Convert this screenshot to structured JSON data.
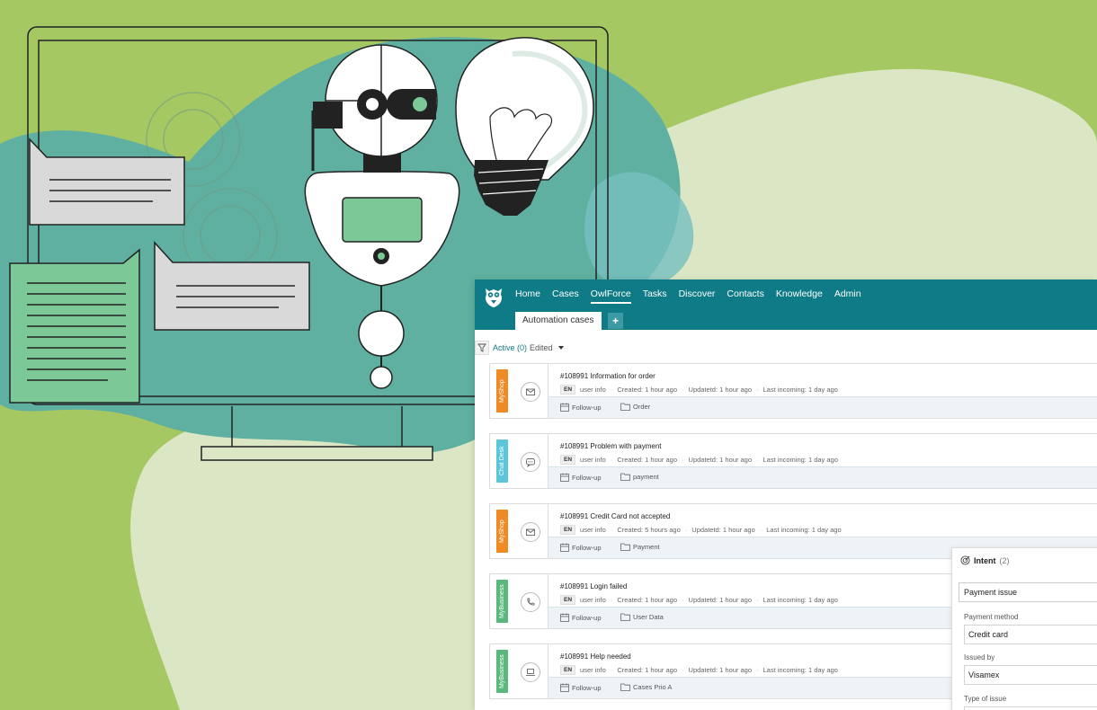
{
  "colors": {
    "teal": "#0f7b86",
    "myshop": "#f08a24",
    "chatdesk": "#5bc6d8",
    "mybusiness": "#5ab87d"
  },
  "nav": {
    "items": [
      "Home",
      "Cases",
      "OwlForce",
      "Tasks",
      "Discover",
      "Contacts",
      "Knowledge",
      "Admin"
    ],
    "active": "OwlForce"
  },
  "tabs": {
    "current": "Automation cases",
    "add_label": "+"
  },
  "filter": {
    "active_label": "Active (0)",
    "edited_label": "Edited"
  },
  "cases": [
    {
      "brand": "MyShop",
      "channel": "envelope-icon",
      "title": "#108991 Information for order",
      "lang": "EN",
      "user": "user info",
      "created": "Created: 1 hour ago",
      "updated": "Updatetd: 1 hour ago",
      "incoming": "Last incoming: 1 day ago",
      "followup": "Follow-up",
      "folder": "Order"
    },
    {
      "brand": "Chat Desk",
      "channel": "chat-icon",
      "title": "#108991 Problem with payment",
      "lang": "EN",
      "user": "user info",
      "created": "Created: 1 hour ago",
      "updated": "Updatetd: 1 hour ago",
      "incoming": "Last incoming: 1 day ago",
      "followup": "Follow-up",
      "folder": "payment"
    },
    {
      "brand": "MyShop",
      "channel": "envelope-icon",
      "title": "#108991 Credit Card not accepted",
      "lang": "EN",
      "user": "user info",
      "created": "Created: 5 hours ago",
      "updated": "Updatetd: 1 hour ago",
      "incoming": "Last incoming: 1 day ago",
      "followup": "Follow-up",
      "folder": "Payment"
    },
    {
      "brand": "MyBusiness",
      "channel": "phone-icon",
      "title": "#108991 Login failed",
      "lang": "EN",
      "user": "user info",
      "created": "Created: 1 hour ago",
      "updated": "Updatetd: 1 hour ago",
      "incoming": "Last incoming: 1 day ago",
      "followup": "Follow-up",
      "folder": "User Data"
    },
    {
      "brand": "MyBusiness",
      "channel": "laptop-icon",
      "title": "#108991 Help needed",
      "lang": "EN",
      "user": "user info",
      "created": "Created: 1 hour ago",
      "updated": "Updatetd: 1 hour ago",
      "incoming": "Last incoming: 1 day ago",
      "followup": "Follow-up",
      "folder": "Cases Prio A"
    }
  ],
  "intent": {
    "title": "Intent",
    "count": "(2)",
    "selected": "Payment issue",
    "fields": [
      {
        "label": "Payment method",
        "value": "Credit card"
      },
      {
        "label": "Issued by",
        "value": "Visamex"
      },
      {
        "label": "Type of issue",
        "value": ""
      }
    ]
  }
}
